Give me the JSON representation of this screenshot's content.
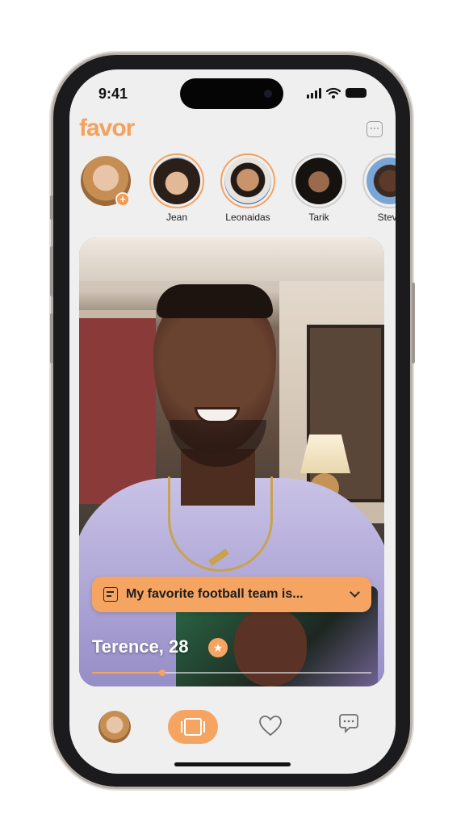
{
  "status_bar": {
    "time": "9:41"
  },
  "app": {
    "name": "favor",
    "accent_color": "#f5a462"
  },
  "header": {
    "messages_icon": "message-square-icon"
  },
  "stories": [
    {
      "name": "",
      "type": "my-story",
      "badge_icon": "plus-icon"
    },
    {
      "name": "Jean",
      "seen": false
    },
    {
      "name": "Leonaidas",
      "seen": false
    },
    {
      "name": "Tarik",
      "seen": true
    },
    {
      "name": "Steve",
      "seen": true
    }
  ],
  "card": {
    "prompt": "My favorite football team is...",
    "name_age": "Terence, 28",
    "badge_icon": "star-icon",
    "video_progress": 0.25
  },
  "tabbar": {
    "items": [
      {
        "id": "profile",
        "icon": "avatar"
      },
      {
        "id": "discover",
        "icon": "cards-icon",
        "active": true
      },
      {
        "id": "likes",
        "icon": "heart-icon"
      },
      {
        "id": "chats",
        "icon": "chat-bubble-icon"
      }
    ]
  }
}
